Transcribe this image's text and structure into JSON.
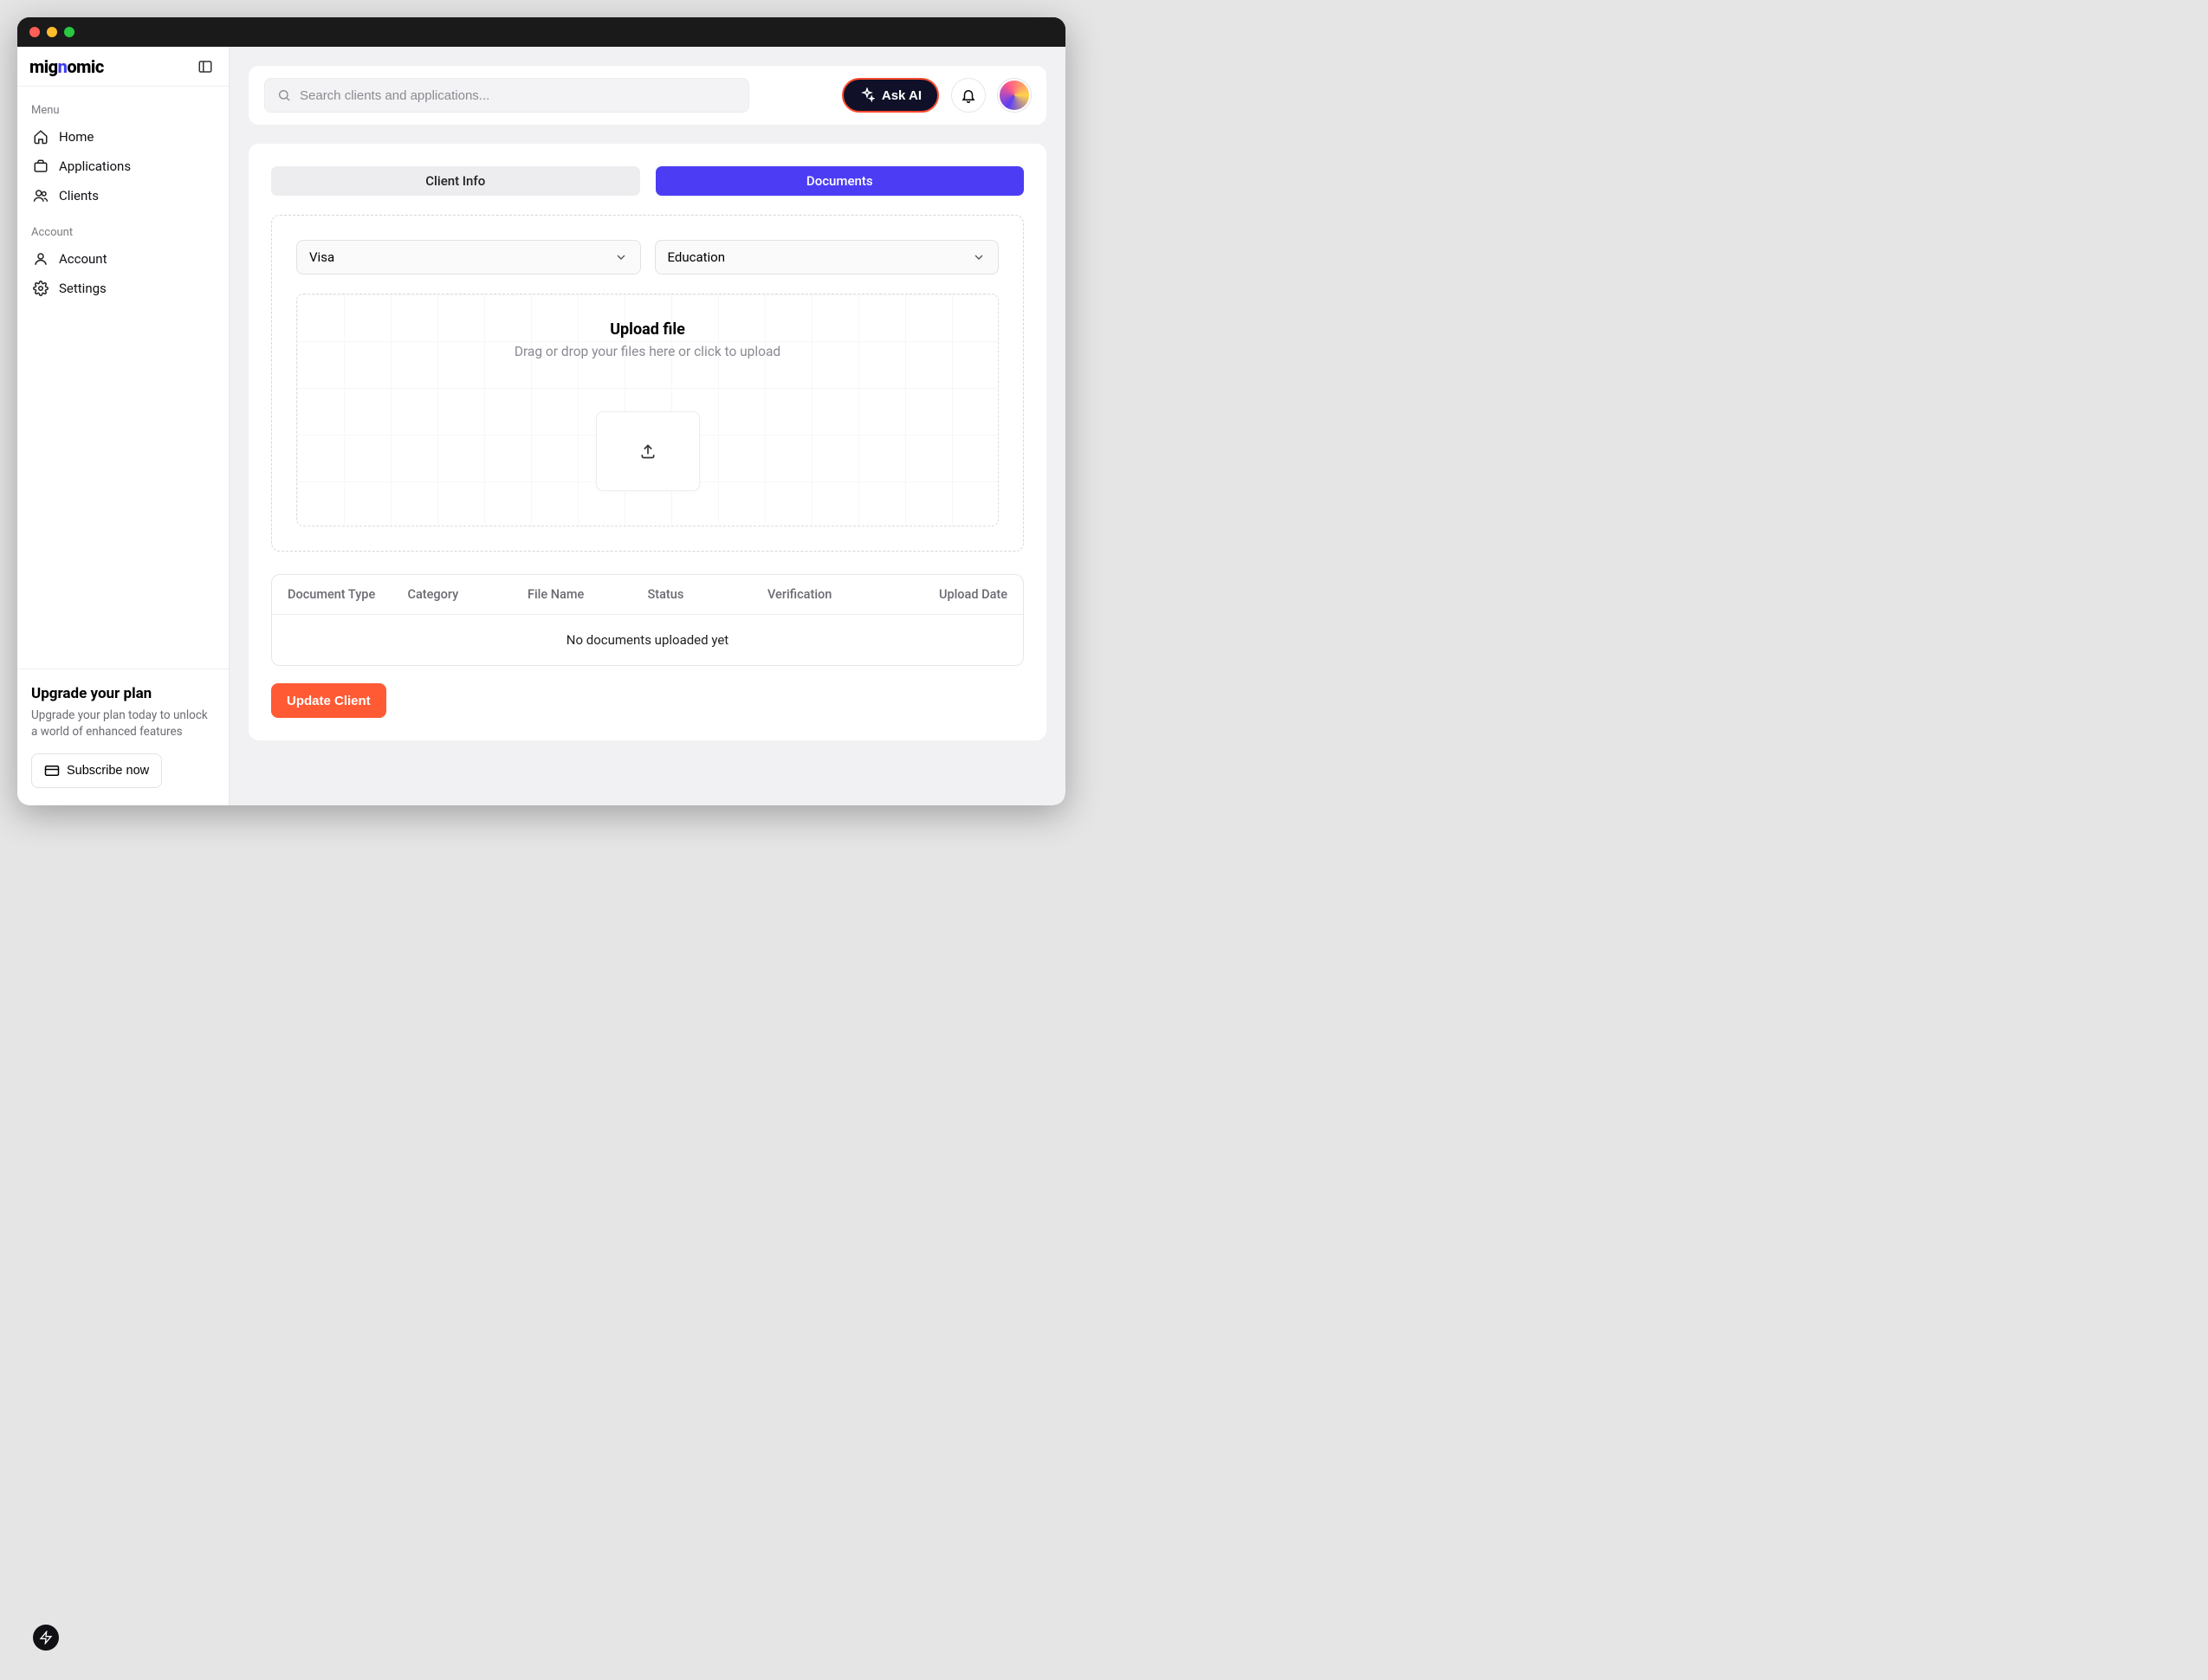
{
  "brand": {
    "pre": "mig",
    "mid": "n",
    "post": "omic"
  },
  "sidebar": {
    "sections": [
      {
        "label": "Menu",
        "items": [
          {
            "icon": "home",
            "label": "Home"
          },
          {
            "icon": "apps",
            "label": "Applications"
          },
          {
            "icon": "clients",
            "label": "Clients"
          }
        ]
      },
      {
        "label": "Account",
        "items": [
          {
            "icon": "user",
            "label": "Account"
          },
          {
            "icon": "gear",
            "label": "Settings"
          }
        ]
      }
    ],
    "upgrade": {
      "title": "Upgrade your plan",
      "text": "Upgrade your plan today to unlock a world of enhanced features",
      "button": "Subscribe now"
    }
  },
  "topbar": {
    "search_placeholder": "Search clients and applications...",
    "ask_ai": "Ask AI"
  },
  "tabs": {
    "client_info": "Client Info",
    "documents": "Documents"
  },
  "selects": {
    "category": "Visa",
    "subcategory": "Education"
  },
  "dropzone": {
    "title": "Upload file",
    "subtitle": "Drag or drop your files here or click to upload"
  },
  "table": {
    "columns": [
      "Document Type",
      "Category",
      "File Name",
      "Status",
      "Verification",
      "Upload Date"
    ],
    "empty": "No documents uploaded yet"
  },
  "actions": {
    "update": "Update Client"
  }
}
